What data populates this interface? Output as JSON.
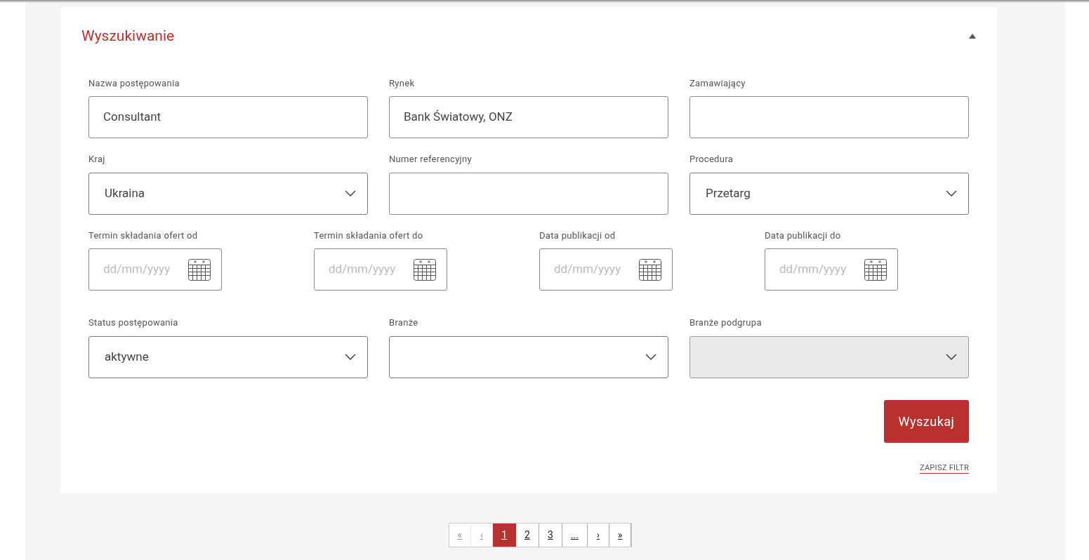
{
  "panel": {
    "title": "Wyszukiwanie",
    "expanded": true
  },
  "rows": [
    {
      "fields": [
        {
          "kind": "text",
          "label": "Nazwa postępowania",
          "value": "Consultant"
        },
        {
          "kind": "text",
          "label": "Rynek",
          "value": "Bank Światowy, ONZ"
        },
        {
          "kind": "text",
          "label": "Zamawiający"
        }
      ]
    },
    {
      "fields": [
        {
          "kind": "select",
          "label": "Kraj",
          "value": "Ukraina",
          "disabled": false
        },
        {
          "kind": "text",
          "label": "Numer referencyjny"
        },
        {
          "kind": "select",
          "label": "Procedura",
          "value": "Przetarg",
          "disabled": false
        }
      ]
    },
    {
      "fields": [
        {
          "kind": "date",
          "label": "Termin składania ofert od",
          "placeholder": "dd/mm/yyyy"
        },
        {
          "kind": "date",
          "label": "Termin składania ofert do",
          "placeholder": "dd/mm/yyyy"
        },
        {
          "kind": "date",
          "label": "Data publikacji od",
          "placeholder": "dd/mm/yyyy"
        },
        {
          "kind": "date",
          "label": "Data publikacji do",
          "placeholder": "dd/mm/yyyy"
        }
      ]
    },
    {
      "fields": [
        {
          "kind": "select",
          "label": "Status postępowania",
          "value": "aktywne",
          "disabled": false
        },
        {
          "kind": "select",
          "label": "Branże",
          "disabled": false
        },
        {
          "kind": "select",
          "label": "Branże podgrupa",
          "disabled": true
        }
      ]
    }
  ],
  "search_button": "Wyszukaj",
  "save_filter_link": "ZAPISZ FILTR",
  "pagination": [
    {
      "label": "«",
      "selected": false,
      "disabled": true
    },
    {
      "label": "‹",
      "selected": false,
      "disabled": true
    },
    {
      "label": "1",
      "selected": true,
      "disabled": false
    },
    {
      "label": "2",
      "selected": false,
      "disabled": false
    },
    {
      "label": "3",
      "selected": false,
      "disabled": false
    },
    {
      "label": "...",
      "selected": false,
      "disabled": false
    },
    {
      "label": "›",
      "selected": false,
      "disabled": false
    },
    {
      "label": "»",
      "selected": false,
      "disabled": false
    }
  ]
}
